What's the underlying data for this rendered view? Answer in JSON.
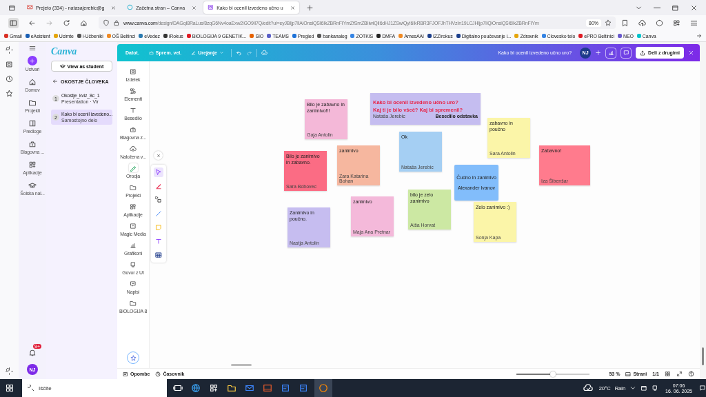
{
  "browser": {
    "tabs": [
      {
        "label": "Prejeto (334) - natasajerebic@g",
        "selected": false,
        "kind": "mail"
      },
      {
        "label": "Začetna stran – Canva",
        "selected": false,
        "kind": "canva"
      },
      {
        "label": "Kako bi ocenil izvedeno učno u",
        "selected": true,
        "kind": "design"
      }
    ],
    "url_host": "www.canva.com",
    "url_path": "/design/DAGqI8RaLus/8zqG6Nv4oaExw2iGO9lI7Q/edit?ui=eyJBIjp7IlAiOnsiQSI6IkZBRnFIYmZfSmZBIiwiQiI6dHJ1ZSwiQyI6IkRBR3FJOFJhTHVzIn19LCJHIjp7IlQiOnsiQSI6IkZBRnFIYm",
    "zoom": "80%",
    "bookmarks": [
      "Gmail",
      "eAsistent",
      "Ucimte",
      "i-Učbeniki",
      "OŠ Beltinci",
      "eVedez",
      "iRokus",
      "BIOLOGIJA 9 GENETIK...",
      "SIO",
      "TEAMS",
      "Pregled",
      "bankanalog",
      "ZOTKIS",
      "DMFA",
      "ArnesAAI",
      "IZZIrokus",
      "Digitalno poučevanje i...",
      "Zdravnik",
      "Clovesko telo",
      "ePRO Beltinici",
      "NEO",
      "Canva"
    ]
  },
  "canva_nav": {
    "items": [
      {
        "label": "Ustvari",
        "kind": "create"
      },
      {
        "label": "Domov",
        "kind": "home"
      },
      {
        "label": "Projekti",
        "kind": "folder"
      },
      {
        "label": "Predloge",
        "kind": "template"
      },
      {
        "label": "Blagovna ...",
        "kind": "brand"
      },
      {
        "label": "Aplikacije",
        "kind": "apps"
      },
      {
        "label": "Šolska nal...",
        "kind": "school"
      }
    ],
    "notification_badge": "9+",
    "avatar": "NJ"
  },
  "panel": {
    "logo": "Canva",
    "button": "View as student",
    "heading": "OKOSTJE ČLOVEKA",
    "items": [
      {
        "number": "1",
        "title": "Okostje_kviz_8c_1",
        "subtitle": "Presentation · Vir",
        "selected": false
      },
      {
        "number": "2",
        "title": "Kako bi ocenil izvedeno...",
        "subtitle": "Samostojno delo",
        "selected": true
      }
    ]
  },
  "toolbar": {
    "file": "Datot.",
    "resize": "Sprem. vel.",
    "editing": "Urejanje",
    "title": "Kako bi ocenil izvedeno učno uro?",
    "avatar": "NJ",
    "share": "Deli z drugimi"
  },
  "tools": [
    {
      "label": "Izdelek",
      "kind": "design",
      "selected": false
    },
    {
      "label": "Elementi",
      "kind": "elements",
      "selected": false
    },
    {
      "label": "Besedilo",
      "kind": "text",
      "selected": false
    },
    {
      "label": "Blagovna z...",
      "kind": "brand",
      "selected": false
    },
    {
      "label": "Naložena v...",
      "kind": "upload",
      "selected": false
    },
    {
      "label": "Orodja",
      "kind": "draw",
      "selected": true
    },
    {
      "label": "Projekti",
      "kind": "folder",
      "selected": false
    },
    {
      "label": "Aplikacije",
      "kind": "apps",
      "selected": false
    },
    {
      "label": "Magic Media",
      "kind": "magic",
      "selected": false
    },
    {
      "label": "Grafikoni",
      "kind": "chart",
      "selected": false
    },
    {
      "label": "Govor z UI",
      "kind": "speech",
      "selected": false
    },
    {
      "label": "Napisi",
      "kind": "captions",
      "selected": false
    },
    {
      "label": "BIOLOGIJA 8",
      "kind": "folder",
      "selected": false
    }
  ],
  "palette": [
    {
      "kind": "select",
      "selected": true
    },
    {
      "kind": "pen",
      "selected": false
    },
    {
      "kind": "shapes",
      "selected": false
    },
    {
      "kind": "line",
      "selected": false
    },
    {
      "kind": "sticky",
      "selected": false
    },
    {
      "kind": "text",
      "selected": false
    },
    {
      "kind": "table",
      "selected": false
    }
  ],
  "notes": [
    {
      "text": "Bilo je zabavno in zanimivo!!!",
      "author": "Gaja Antolin",
      "color": "#f4b8d8"
    },
    {
      "kind": "header",
      "text": "Kako bi ocenil izvedeno učno uro?",
      "text2": "Kaj ti je bilo všeč? Kaj bi spremenil?",
      "author": "Nataša Jerebic",
      "label": "Besedilo odstavka",
      "color": "#c5bdf0"
    },
    {
      "text": "zabavno in poučno",
      "author": "Sara Antolin",
      "color": "#fbf5a8"
    },
    {
      "text": "Bilo je zanimivo in zabavno.",
      "author": "Sara Bobovec",
      "color": "#fb6c84"
    },
    {
      "text": "zanimivo",
      "author": "Zara Katarina Bohan",
      "color": "#f6b79f"
    },
    {
      "text": "Ok",
      "author": "Nataša Jerebic",
      "color": "#a5cff3"
    },
    {
      "kind": "centered",
      "text": "Čudno in zanimivo",
      "author": "Alexander Ivanov",
      "color": "#82bdfb"
    },
    {
      "text": "Zabavno!",
      "author": "Iza Šibenšar",
      "color": "#ff7b8d"
    },
    {
      "text": "Zanimivo in poučno.",
      "author": "Nastja Antolin",
      "color": "#c6bdf0"
    },
    {
      "text": "zanimivo",
      "author": "Maja Ana Pretnar",
      "color": "#f4b9da"
    },
    {
      "text": "bilo je zelo zanimivo",
      "author": "Aiša Horvat",
      "color": "#cce8a3"
    },
    {
      "text": "Zelo zanimivo :)",
      "author": "Sonja Kapa",
      "color": "#fbf5a8"
    }
  ],
  "footer": {
    "notes": "Opombe",
    "timer": "Časovnik",
    "zoom_slider": {
      "level": 0.5
    },
    "zoom": "53 %",
    "pages": "Strani",
    "page_count": "1/1"
  },
  "taskbar": {
    "search": "Iščite",
    "temperature": "20°C",
    "weather": "Rain",
    "time": "07:06",
    "date": "16. 06. 2025"
  }
}
